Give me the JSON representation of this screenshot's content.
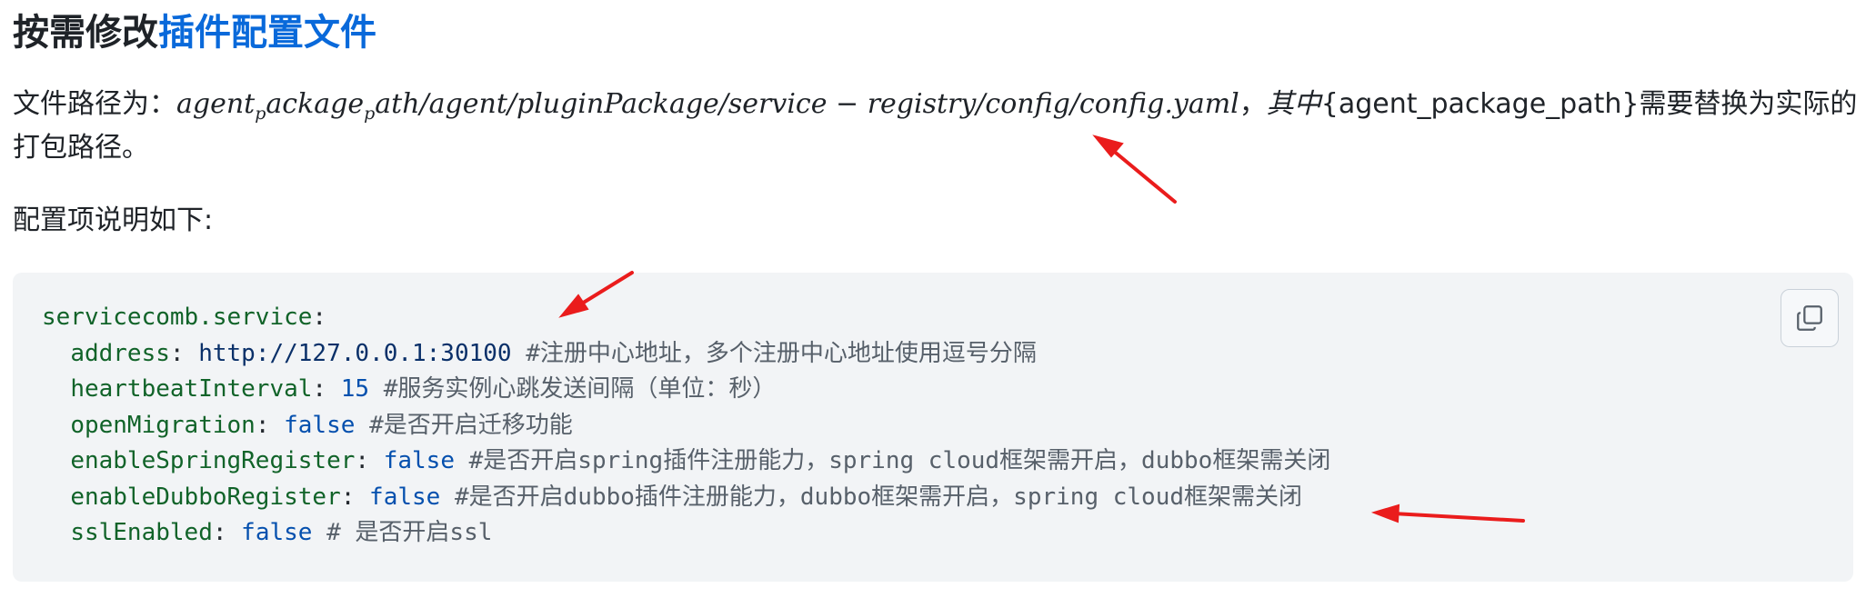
{
  "heading": {
    "prefix": "按需修改",
    "link": "插件配置文件"
  },
  "path_line": {
    "label": "文件路径为：",
    "math_part1": "agent",
    "math_sub1": "p",
    "math_part2": "ackage",
    "math_sub2": "p",
    "math_part3": "ath/agent/pluginPackage/service − registry/config/config.yaml",
    "comma": "，",
    "math_part4": "其中",
    "placeholder_text": "{agent_package_path}",
    "suffix": "需要替换为实际的",
    "continuation": "打包路径。"
  },
  "config_intro": "配置项说明如下:",
  "code": {
    "root_key": "servicecomb.service",
    "lines": [
      {
        "key": "address",
        "value": "http://127.0.0.1:30100",
        "comment": "#注册中心地址，多个注册中心地址使用逗号分隔"
      },
      {
        "key": "heartbeatInterval",
        "value": "15",
        "comment": "#服务实例心跳发送间隔（单位：秒）"
      },
      {
        "key": "openMigration",
        "value": "false",
        "comment": "#是否开启迁移功能"
      },
      {
        "key": "enableSpringRegister",
        "value": "false",
        "comment": "#是否开启spring插件注册能力，spring cloud框架需开启，dubbo框架需关闭"
      },
      {
        "key": "enableDubboRegister",
        "value": "false",
        "comment": "#是否开启dubbo插件注册能力，dubbo框架需开启，spring cloud框架需关闭"
      },
      {
        "key": "sslEnabled",
        "value": "false",
        "comment": "# 是否开启ssl"
      }
    ]
  },
  "colors": {
    "link": "#0969da",
    "annotation_arrow": "#ea1c1c",
    "code_background": "#f2f4f6"
  },
  "icons": {
    "copy": "copy-icon"
  }
}
